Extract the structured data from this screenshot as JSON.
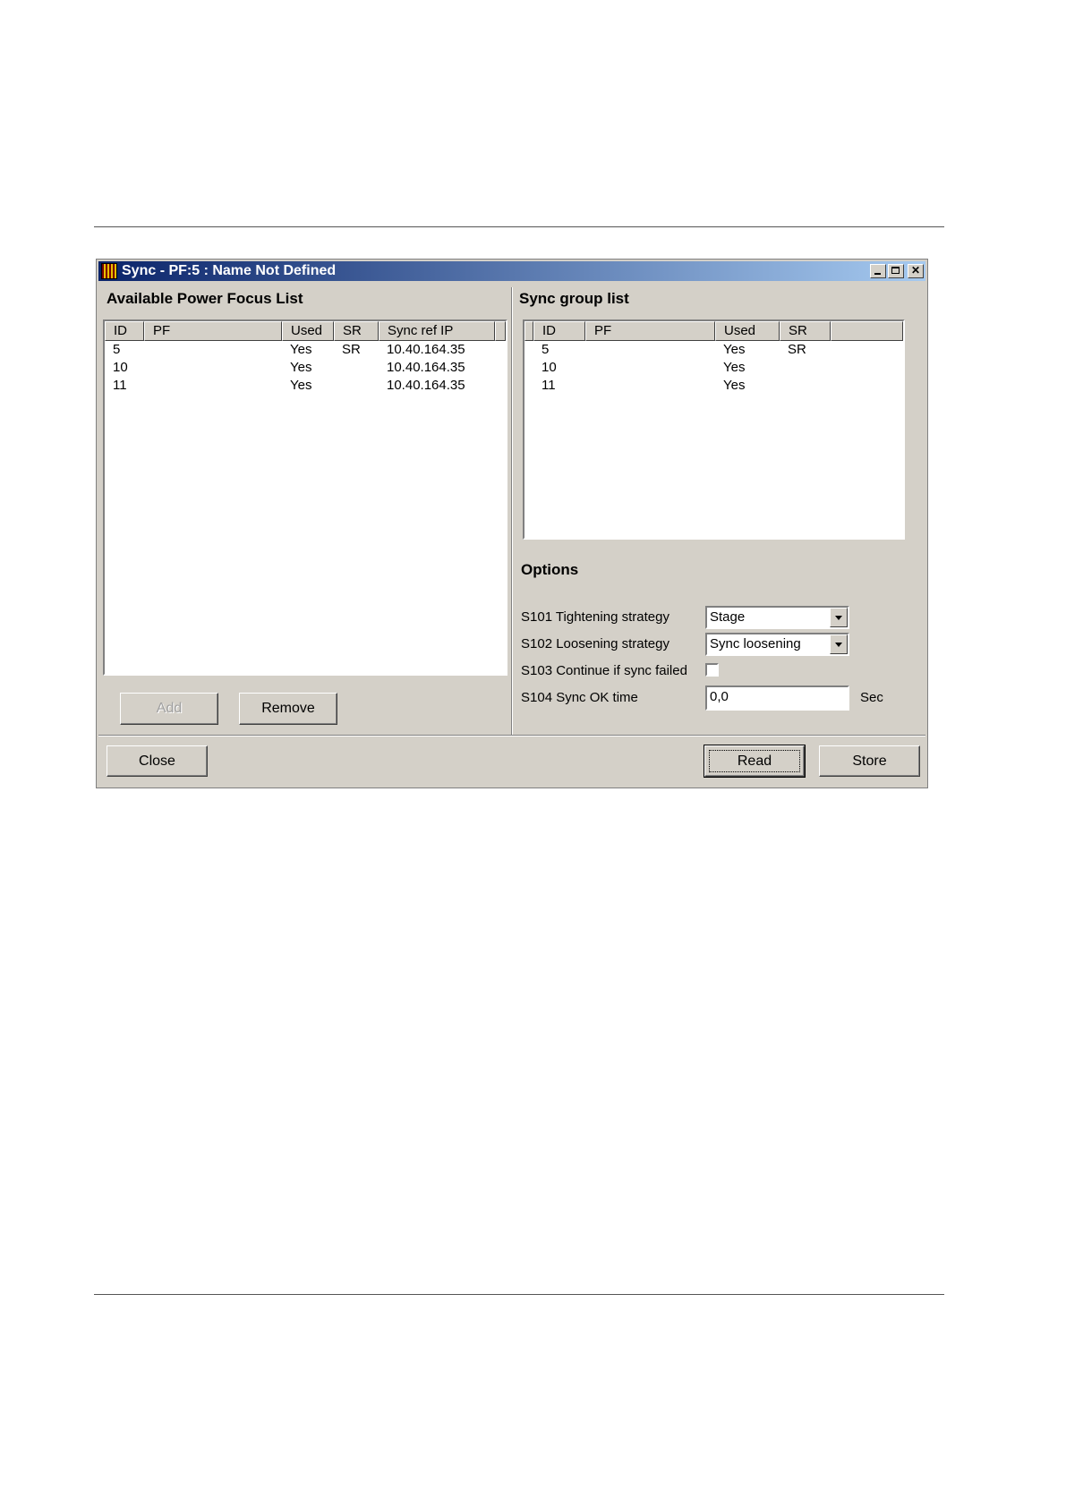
{
  "window": {
    "title": "Sync - PF:5 : Name Not Defined",
    "min_icon": "minimize-icon",
    "max_icon": "maximize-icon",
    "close_glyph": "✕"
  },
  "available_list": {
    "title": "Available Power Focus List",
    "columns": [
      "ID",
      "PF",
      "Used",
      "SR",
      "Sync ref IP"
    ],
    "rows": [
      {
        "id": "5",
        "pf": "",
        "used": "Yes",
        "sr": "SR",
        "ip": "10.40.164.35"
      },
      {
        "id": "10",
        "pf": "",
        "used": "Yes",
        "sr": "",
        "ip": "10.40.164.35"
      },
      {
        "id": "11",
        "pf": "",
        "used": "Yes",
        "sr": "",
        "ip": "10.40.164.35"
      }
    ],
    "add_label": "Add",
    "remove_label": "Remove"
  },
  "sync_group": {
    "title": "Sync group list",
    "columns": [
      "ID",
      "PF",
      "Used",
      "SR"
    ],
    "rows": [
      {
        "id": "5",
        "pf": "",
        "used": "Yes",
        "sr": "SR"
      },
      {
        "id": "10",
        "pf": "",
        "used": "Yes",
        "sr": ""
      },
      {
        "id": "11",
        "pf": "",
        "used": "Yes",
        "sr": ""
      }
    ]
  },
  "options": {
    "title": "Options",
    "tightening_label": "S101 Tightening strategy",
    "tightening_value": "Stage",
    "loosening_label": "S102 Loosening strategy",
    "loosening_value": "Sync loosening",
    "continue_label": "S103 Continue if sync failed",
    "continue_checked": false,
    "sync_ok_label": "S104 Sync OK time",
    "sync_ok_value": "0,0",
    "sync_ok_unit": "Sec"
  },
  "footer": {
    "close_label": "Close",
    "read_label": "Read",
    "store_label": "Store"
  }
}
